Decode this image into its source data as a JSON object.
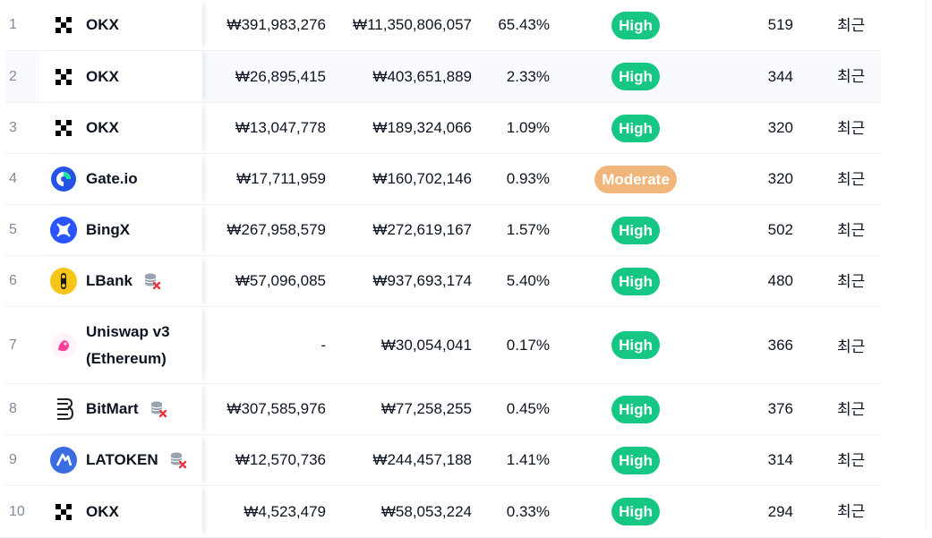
{
  "colors": {
    "high": "#16c784",
    "moderate": "#f0b67c",
    "rank_text": "#808a9d",
    "border": "#eff2f5"
  },
  "rows": [
    {
      "rank": "1",
      "exchange": "OKX",
      "icon": "okx-icon",
      "spot": "₩391,983,276",
      "volume": "₩11,350,806,057",
      "pct": "65.43%",
      "liquidity": "High",
      "score": "519",
      "updated": "최근",
      "warn": false
    },
    {
      "rank": "2",
      "exchange": "OKX",
      "icon": "okx-icon",
      "spot": "₩26,895,415",
      "volume": "₩403,651,889",
      "pct": "2.33%",
      "liquidity": "High",
      "score": "344",
      "updated": "최근",
      "warn": false
    },
    {
      "rank": "3",
      "exchange": "OKX",
      "icon": "okx-icon",
      "spot": "₩13,047,778",
      "volume": "₩189,324,066",
      "pct": "1.09%",
      "liquidity": "High",
      "score": "320",
      "updated": "최근",
      "warn": false
    },
    {
      "rank": "4",
      "exchange": "Gate.io",
      "icon": "gateio-icon",
      "spot": "₩17,711,959",
      "volume": "₩160,702,146",
      "pct": "0.93%",
      "liquidity": "Moderate",
      "score": "320",
      "updated": "최근",
      "warn": false
    },
    {
      "rank": "5",
      "exchange": "BingX",
      "icon": "bingx-icon",
      "spot": "₩267,958,579",
      "volume": "₩272,619,167",
      "pct": "1.57%",
      "liquidity": "High",
      "score": "502",
      "updated": "최근",
      "warn": false
    },
    {
      "rank": "6",
      "exchange": "LBank",
      "icon": "lbank-icon",
      "spot": "₩57,096,085",
      "volume": "₩937,693,174",
      "pct": "5.40%",
      "liquidity": "High",
      "score": "480",
      "updated": "최근",
      "warn": true
    },
    {
      "rank": "7",
      "exchange": "Uniswap v3 (Ethereum)",
      "icon": "uniswap-icon",
      "spot": "-",
      "volume": "₩30,054,041",
      "pct": "0.17%",
      "liquidity": "High",
      "score": "366",
      "updated": "최근",
      "warn": false
    },
    {
      "rank": "8",
      "exchange": "BitMart",
      "icon": "bitmart-icon",
      "spot": "₩307,585,976",
      "volume": "₩77,258,255",
      "pct": "0.45%",
      "liquidity": "High",
      "score": "376",
      "updated": "최근",
      "warn": true
    },
    {
      "rank": "9",
      "exchange": "LATOKEN",
      "icon": "latoken-icon",
      "spot": "₩12,570,736",
      "volume": "₩244,457,188",
      "pct": "1.41%",
      "liquidity": "High",
      "score": "314",
      "updated": "최근",
      "warn": true
    },
    {
      "rank": "10",
      "exchange": "OKX",
      "icon": "okx-icon",
      "spot": "₩4,523,479",
      "volume": "₩58,053,224",
      "pct": "0.33%",
      "liquidity": "High",
      "score": "294",
      "updated": "최근",
      "warn": false
    }
  ]
}
